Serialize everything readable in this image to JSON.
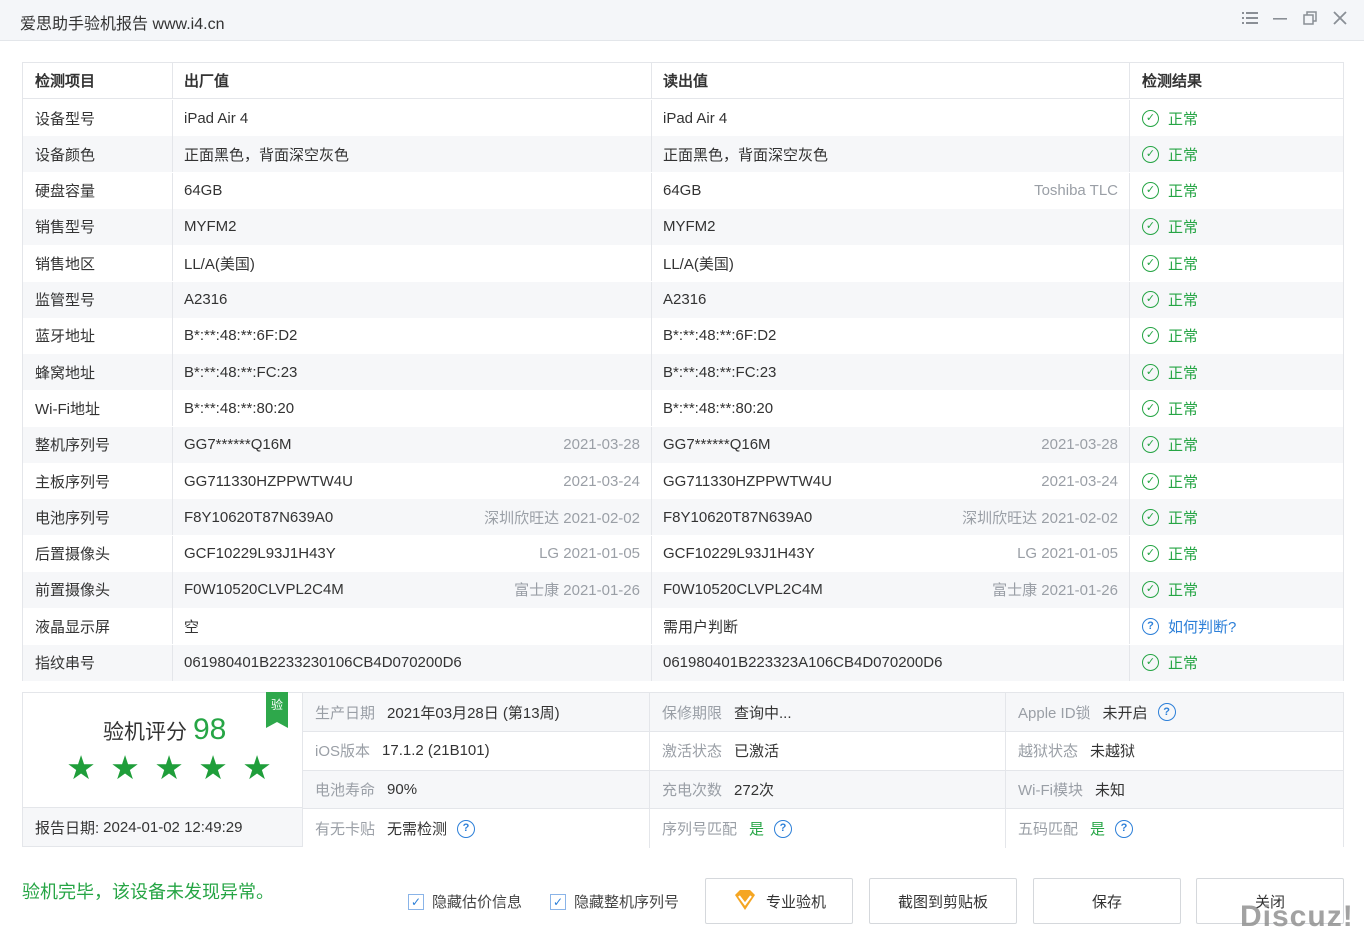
{
  "window": {
    "title": "爱思助手验机报告 www.i4.cn",
    "controls": [
      "menu-icon",
      "minimize-icon",
      "restore-icon",
      "close-icon"
    ]
  },
  "table": {
    "headers": [
      "检测项目",
      "出厂值",
      "读出值",
      "检测结果"
    ],
    "rows": [
      {
        "item": "设备型号",
        "factory": "iPad Air 4",
        "factory_note": "",
        "read": "iPad Air 4",
        "read_note": "",
        "result": "正常",
        "status": "ok"
      },
      {
        "item": "设备颜色",
        "factory": "正面黑色，背面深空灰色",
        "factory_note": "",
        "read": "正面黑色，背面深空灰色",
        "read_note": "",
        "result": "正常",
        "status": "ok"
      },
      {
        "item": "硬盘容量",
        "factory": "64GB",
        "factory_note": "",
        "read": "64GB",
        "read_note": "Toshiba TLC",
        "result": "正常",
        "status": "ok"
      },
      {
        "item": "销售型号",
        "factory": "MYFM2",
        "factory_note": "",
        "read": "MYFM2",
        "read_note": "",
        "result": "正常",
        "status": "ok"
      },
      {
        "item": "销售地区",
        "factory": "LL/A(美国)",
        "factory_note": "",
        "read": "LL/A(美国)",
        "read_note": "",
        "result": "正常",
        "status": "ok"
      },
      {
        "item": "监管型号",
        "factory": "A2316",
        "factory_note": "",
        "read": "A2316",
        "read_note": "",
        "result": "正常",
        "status": "ok"
      },
      {
        "item": "蓝牙地址",
        "factory": "B*:**:48:**:6F:D2",
        "factory_note": "",
        "read": "B*:**:48:**:6F:D2",
        "read_note": "",
        "result": "正常",
        "status": "ok"
      },
      {
        "item": "蜂窝地址",
        "factory": "B*:**:48:**:FC:23",
        "factory_note": "",
        "read": "B*:**:48:**:FC:23",
        "read_note": "",
        "result": "正常",
        "status": "ok"
      },
      {
        "item": "Wi-Fi地址",
        "factory": "B*:**:48:**:80:20",
        "factory_note": "",
        "read": "B*:**:48:**:80:20",
        "read_note": "",
        "result": "正常",
        "status": "ok"
      },
      {
        "item": "整机序列号",
        "factory": "GG7******Q16M",
        "factory_note": "2021-03-28",
        "read": "GG7******Q16M",
        "read_note": "2021-03-28",
        "result": "正常",
        "status": "ok"
      },
      {
        "item": "主板序列号",
        "factory": "GG711330HZPPWTW4U",
        "factory_note": "2021-03-24",
        "read": "GG711330HZPPWTW4U",
        "read_note": "2021-03-24",
        "result": "正常",
        "status": "ok"
      },
      {
        "item": "电池序列号",
        "factory": "F8Y10620T87N639A0",
        "factory_note": "深圳欣旺达 2021-02-02",
        "read": "F8Y10620T87N639A0",
        "read_note": "深圳欣旺达 2021-02-02",
        "result": "正常",
        "status": "ok"
      },
      {
        "item": "后置摄像头",
        "factory": "GCF10229L93J1H43Y",
        "factory_note": "LG 2021-01-05",
        "read": "GCF10229L93J1H43Y",
        "read_note": "LG 2021-01-05",
        "result": "正常",
        "status": "ok"
      },
      {
        "item": "前置摄像头",
        "factory": "F0W10520CLVPL2C4M",
        "factory_note": "富士康 2021-01-26",
        "read": "F0W10520CLVPL2C4M",
        "read_note": "富士康 2021-01-26",
        "result": "正常",
        "status": "ok"
      },
      {
        "item": "液晶显示屏",
        "factory": "空",
        "factory_note": "",
        "read": "需用户判断",
        "read_note": "",
        "result": "如何判断?",
        "status": "help"
      },
      {
        "item": "指纹串号",
        "factory": "061980401B2233230106CB4D070200D6",
        "factory_note": "",
        "read": "061980401B223323A106CB4D070200D6",
        "read_note": "",
        "result": "正常",
        "status": "ok"
      }
    ]
  },
  "summary": {
    "score_label": "验机评分",
    "score": "98",
    "stars": 5,
    "badge": "验",
    "report_date_label": "报告日期:",
    "report_date": "2024-01-02 12:49:29",
    "rows": [
      [
        {
          "key": "生产日期",
          "value": "2021年03月28日 (第13周)",
          "help": false,
          "green": false
        },
        {
          "key": "保修期限",
          "value": "查询中...",
          "help": false,
          "green": false
        },
        {
          "key": "Apple ID锁",
          "value": "未开启",
          "help": true,
          "green": false
        }
      ],
      [
        {
          "key": "iOS版本",
          "value": "17.1.2 (21B101)",
          "help": false,
          "green": false
        },
        {
          "key": "激活状态",
          "value": "已激活",
          "help": false,
          "green": false
        },
        {
          "key": "越狱状态",
          "value": "未越狱",
          "help": false,
          "green": false
        }
      ],
      [
        {
          "key": "电池寿命",
          "value": "90%",
          "help": false,
          "green": false
        },
        {
          "key": "充电次数",
          "value": "272次",
          "help": false,
          "green": false
        },
        {
          "key": "Wi-Fi模块",
          "value": "未知",
          "help": false,
          "green": false
        }
      ],
      [
        {
          "key": "有无卡贴",
          "value": "无需检测",
          "help": true,
          "green": false
        },
        {
          "key": "序列号匹配",
          "value": "是",
          "help": true,
          "green": true
        },
        {
          "key": "五码匹配",
          "value": "是",
          "help": true,
          "green": true
        }
      ]
    ]
  },
  "footer": {
    "result_message": "验机完毕，该设备未发现异常。",
    "checkbox_hide_valuation": "隐藏估价信息",
    "checkbox_hide_serial": "隐藏整机序列号",
    "btn_pro": "专业验机",
    "btn_screenshot": "截图到剪贴板",
    "btn_save": "保存",
    "btn_close": "关闭",
    "watermark": "Discuz!"
  },
  "colors": {
    "ok": "#26a545",
    "help": "#2c7fd8",
    "row_alt": "#f6f7f9",
    "border": "#e4e6ea"
  }
}
